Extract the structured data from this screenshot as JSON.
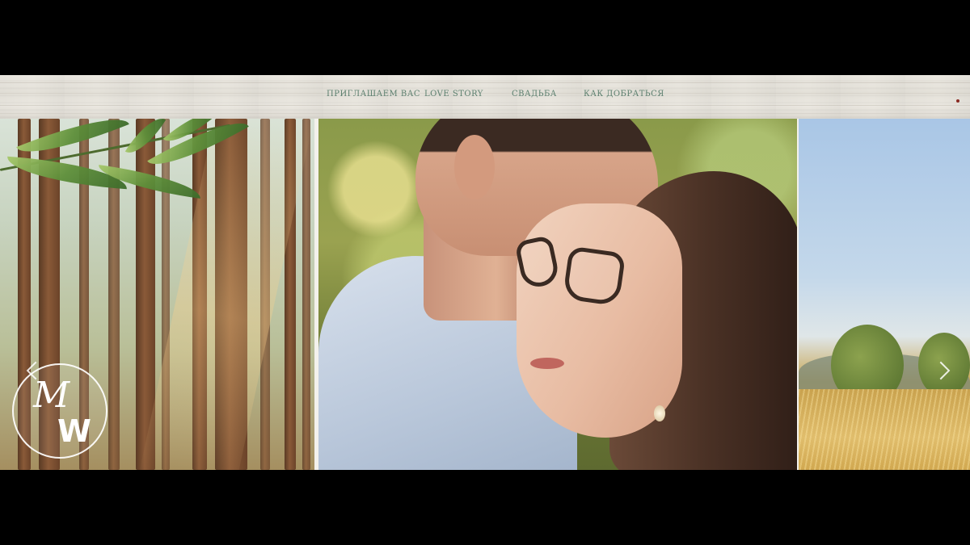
{
  "nav": {
    "items": [
      {
        "label": "ПРИГЛАШАЕМ ВАС"
      },
      {
        "label": "LOVE STORY"
      },
      {
        "label": "СВАДЬБА"
      },
      {
        "label": "КАК ДОБРАТЬСЯ"
      }
    ]
  },
  "logo": {
    "letter_top": "M",
    "letter_bottom": "W"
  },
  "colors": {
    "nav_text": "#5b7f6e",
    "navbar_bg": "#e6e3dc",
    "frame_bg": "#000000"
  },
  "icons": {
    "prev": "chevron-left-icon",
    "next": "chevron-right-icon"
  }
}
